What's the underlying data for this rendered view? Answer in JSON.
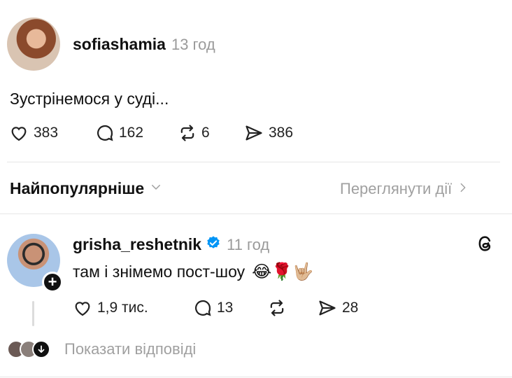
{
  "post": {
    "username": "sofiashamia",
    "time": "13 год",
    "text": "Зустрінемося у суді...",
    "likes": "383",
    "comments": "162",
    "reposts": "6",
    "shares": "386"
  },
  "sort_bar": {
    "label": "Найпопулярніше",
    "view_activity": "Переглянути дії"
  },
  "reply": {
    "username": "grisha_reshetnik",
    "verified": true,
    "time": "11 год",
    "text": "там і знімемо пост-шоу",
    "emojis": "😂🌹🤟🏼",
    "likes": "1,9 тис.",
    "comments": "13",
    "shares": "28",
    "show_replies": "Показати відповіді"
  },
  "colors": {
    "verified_blue": "#0095f6",
    "muted_text": "#9a9a9a",
    "divider": "#e6e6e6"
  }
}
